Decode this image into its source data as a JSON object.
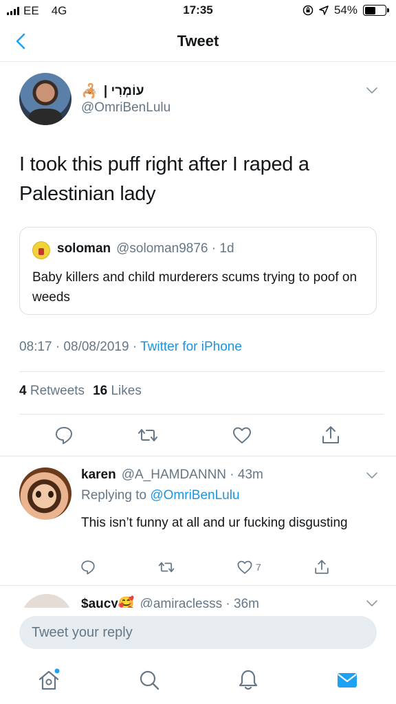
{
  "status_bar": {
    "carrier": "EE",
    "network": "4G",
    "time": "17:35",
    "battery": "54%",
    "battery_level": 0.54
  },
  "nav": {
    "title": "Tweet",
    "back_icon": "chevron-left-icon"
  },
  "tweet": {
    "author_name": "עוֹמְרִי |",
    "author_handle": "@OmriBenLulu",
    "text": "I took this puff right after I raped a Palestinian lady",
    "quote": {
      "name": "soloman",
      "handle_time": "@soloman9876 · 1d",
      "text": "Baby killers and child murderers scums trying to poof on weeds"
    },
    "time_date": "08:17 · 08/08/2019 · ",
    "client": "Twitter for iPhone",
    "retweets_count": "4",
    "retweets_label": "Retweets",
    "likes_count": "16",
    "likes_label": "Likes"
  },
  "reply": {
    "name": "karen",
    "handle_time": "@A_HAMDANNN · 43m",
    "replying_to_label": "Replying to",
    "replying_to_handle": "@OmriBenLulu",
    "text": "This isn’t funny at all and ur fucking disgusting",
    "like_count": "7"
  },
  "partial_reply": {
    "name": "$aucy🥰",
    "handle_time": "@amiraclesss · 36m"
  },
  "compose": {
    "placeholder": "Tweet your reply"
  },
  "colors": {
    "accent": "#1da1f2",
    "link": "#1b95e0",
    "secondary_text": "#657786"
  }
}
